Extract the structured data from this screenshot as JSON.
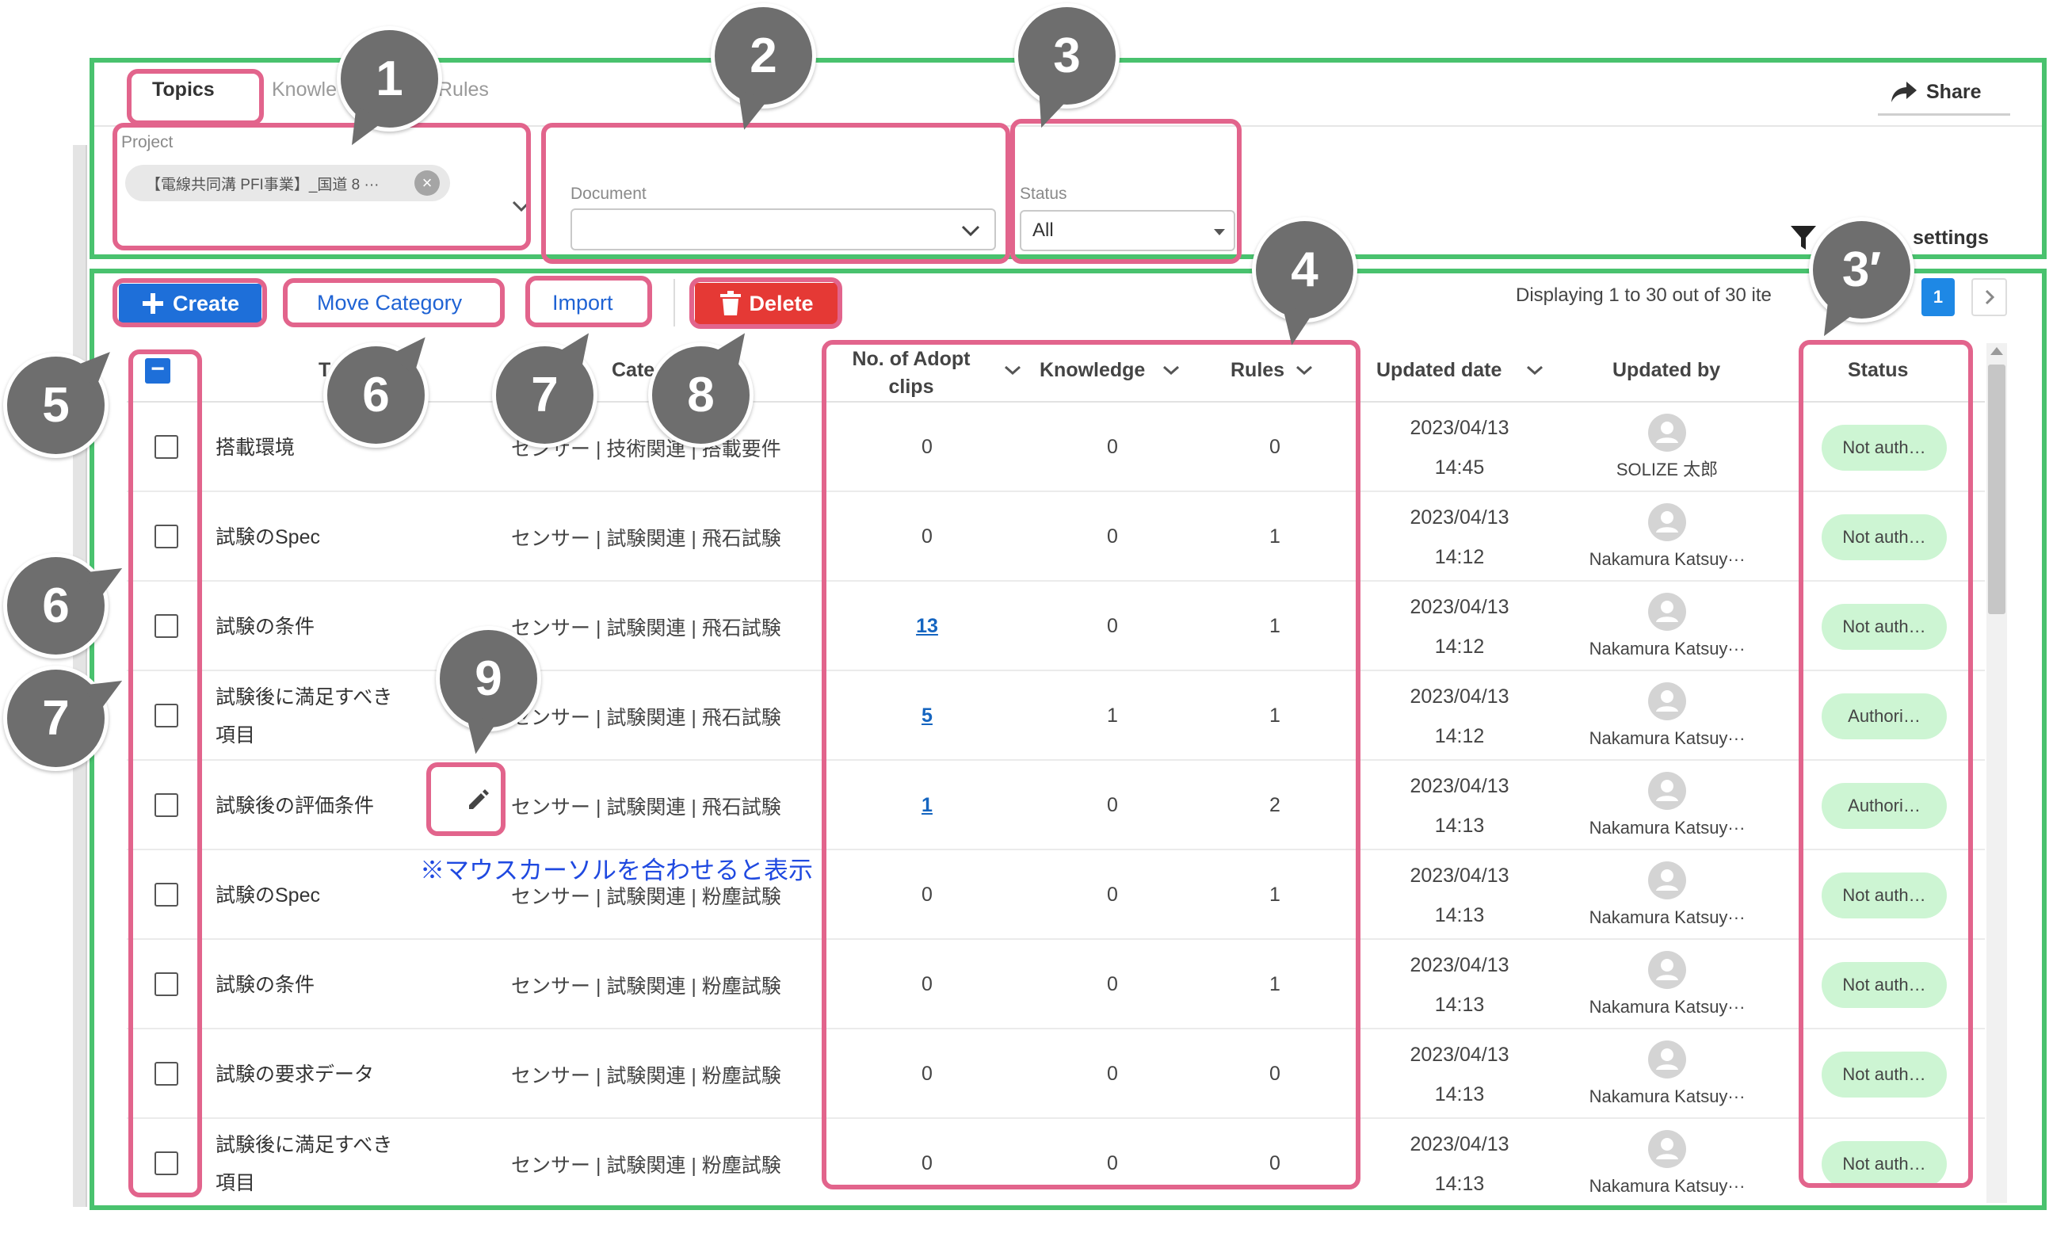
{
  "tabs": [
    {
      "label": "Topics"
    },
    {
      "label": "Knowle"
    },
    {
      "label": "Rules"
    }
  ],
  "share_label": "Share",
  "filters": {
    "project_label": "Project",
    "project_chip": "【電線共同溝 PFI事業】_国道 8 ···",
    "document_label": "Document",
    "document_value": "",
    "status_label": "Status",
    "status_value": "All",
    "settings_label": "settings"
  },
  "toolbar": {
    "create": "Create",
    "move_category": "Move Category",
    "import": "Import",
    "delete": "Delete"
  },
  "pagination": {
    "summary": "Displaying 1 to 30 out of 30 ite",
    "current_page": "1"
  },
  "table": {
    "headers": {
      "title": "T",
      "category": "Cate",
      "clips_line1": "No. of Adopt",
      "clips_line2": "clips",
      "knowledge": "Knowledge",
      "rules": "Rules",
      "updated_date": "Updated date",
      "updated_by": "Updated by",
      "status": "Status"
    },
    "rows": [
      {
        "title": "搭載環境",
        "category": "センサー | 技術関連 | 搭載要件",
        "clips": "0",
        "clips_linked": false,
        "knowledge": "0",
        "rules": "0",
        "date": "2023/04/13",
        "time": "14:45",
        "updated_by": "SOLIZE 太郎",
        "status": "Not auth…"
      },
      {
        "title": "試験のSpec",
        "category": "センサー | 試験関連 | 飛石試験",
        "clips": "0",
        "clips_linked": false,
        "knowledge": "0",
        "rules": "1",
        "date": "2023/04/13",
        "time": "14:12",
        "updated_by": "Nakamura Katsuy···",
        "status": "Not auth…"
      },
      {
        "title": "試験の条件",
        "category": "センサー | 試験関連 | 飛石試験",
        "clips": "13",
        "clips_linked": true,
        "knowledge": "0",
        "rules": "1",
        "date": "2023/04/13",
        "time": "14:12",
        "updated_by": "Nakamura Katsuy···",
        "status": "Not auth…"
      },
      {
        "title": "試験後に満足すべき項目",
        "category": "センサー | 試験関連 | 飛石試験",
        "clips": "5",
        "clips_linked": true,
        "knowledge": "1",
        "rules": "1",
        "date": "2023/04/13",
        "time": "14:12",
        "updated_by": "Nakamura Katsuy···",
        "status": "Authori…"
      },
      {
        "title": "試験後の評価条件",
        "category": "センサー | 試験関連 | 飛石試験",
        "clips": "1",
        "clips_linked": true,
        "knowledge": "0",
        "rules": "2",
        "date": "2023/04/13",
        "time": "14:13",
        "updated_by": "Nakamura Katsuy···",
        "status": "Authori…"
      },
      {
        "title": "試験のSpec",
        "category": "センサー | 試験関連 | 粉塵試験",
        "clips": "0",
        "clips_linked": false,
        "knowledge": "0",
        "rules": "1",
        "date": "2023/04/13",
        "time": "14:13",
        "updated_by": "Nakamura Katsuy···",
        "status": "Not auth…"
      },
      {
        "title": "試験の条件",
        "category": "センサー | 試験関連 | 粉塵試験",
        "clips": "0",
        "clips_linked": false,
        "knowledge": "0",
        "rules": "1",
        "date": "2023/04/13",
        "time": "14:13",
        "updated_by": "Nakamura Katsuy···",
        "status": "Not auth…"
      },
      {
        "title": "試験の要求データ",
        "category": "センサー | 試験関連 | 粉塵試験",
        "clips": "0",
        "clips_linked": false,
        "knowledge": "0",
        "rules": "0",
        "date": "2023/04/13",
        "time": "14:13",
        "updated_by": "Nakamura Katsuy···",
        "status": "Not auth…"
      },
      {
        "title": "試験後に満足すべき項目",
        "category": "センサー | 試験関連 | 粉塵試験",
        "clips": "0",
        "clips_linked": false,
        "knowledge": "0",
        "rules": "0",
        "date": "2023/04/13",
        "time": "14:13",
        "updated_by": "Nakamura Katsuy···",
        "status": "Not auth…"
      }
    ]
  },
  "annotation": {
    "hover_note": "※マウスカーソルを合わせると表示"
  },
  "callouts": [
    "1",
    "2",
    "3",
    "4",
    "3′",
    "5",
    "6",
    "7",
    "8",
    "6",
    "7",
    "9"
  ],
  "colors": {
    "primary": "#1e6fd9",
    "danger": "#e53935",
    "frame_green": "#49c26e",
    "frame_pink": "#e2648c",
    "callout_gray": "#6e6e6e",
    "status_pill": "#cdf5d3",
    "link": "#1565c0",
    "note": "#1f49e0"
  }
}
